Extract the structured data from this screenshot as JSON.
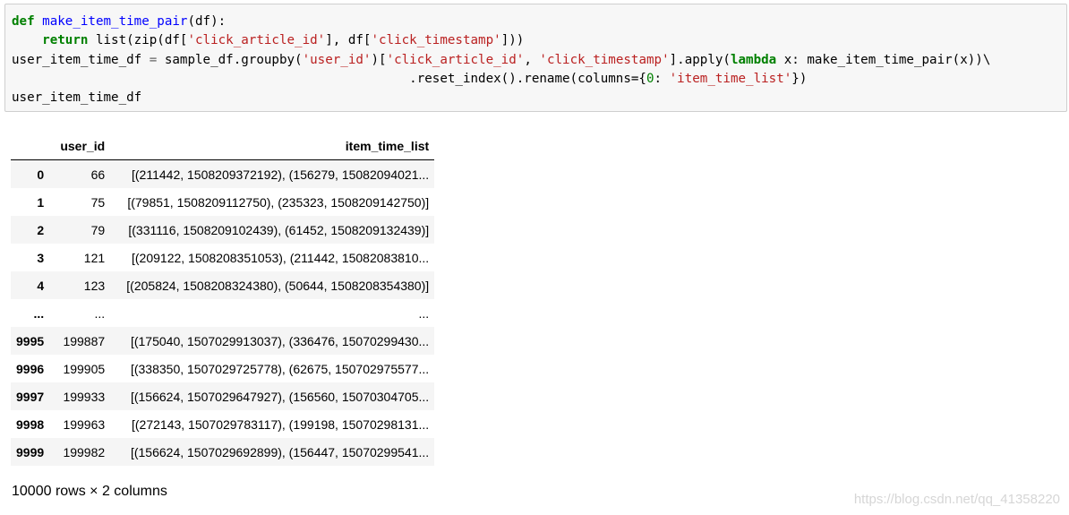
{
  "code": {
    "line1": {
      "kw": "def",
      "name": "make_item_time_pair",
      "rest": "(df):"
    },
    "line2": {
      "indent": "    ",
      "kw": "return",
      "p1": " list(zip(df[",
      "s1": "'click_article_id'",
      "p2": "], df[",
      "s2": "'click_timestamp'",
      "p3": "]))"
    },
    "line3": {
      "p1": "user_item_time_df ",
      "eq": "=",
      "p2": " sample_df.groupby(",
      "s1": "'user_id'",
      "p3": ")[",
      "s2": "'click_article_id'",
      "p4": ", ",
      "s3": "'click_timestamp'",
      "p5": "].apply(",
      "kw": "lambda",
      "p6": " x: make_item_time_pair(x))\\"
    },
    "line4": {
      "indent": "                                                    ",
      "p1": ".reset_index().rename(columns={",
      "num": "0",
      "p2": ": ",
      "s1": "'item_time_list'",
      "p3": "})"
    },
    "line5": "user_item_time_df"
  },
  "table": {
    "columns": [
      "",
      "user_id",
      "item_time_list"
    ],
    "rows": [
      {
        "index": "0",
        "user_id": "66",
        "item_time_list": "[(211442, 1508209372192), (156279, 15082094021..."
      },
      {
        "index": "1",
        "user_id": "75",
        "item_time_list": "[(79851, 1508209112750), (235323, 1508209142750)]"
      },
      {
        "index": "2",
        "user_id": "79",
        "item_time_list": "[(331116, 1508209102439), (61452, 1508209132439)]"
      },
      {
        "index": "3",
        "user_id": "121",
        "item_time_list": "[(209122, 1508208351053), (211442, 15082083810..."
      },
      {
        "index": "4",
        "user_id": "123",
        "item_time_list": "[(205824, 1508208324380), (50644, 1508208354380)]"
      },
      {
        "index": "...",
        "user_id": "...",
        "item_time_list": "..."
      },
      {
        "index": "9995",
        "user_id": "199887",
        "item_time_list": "[(175040, 1507029913037), (336476, 15070299430..."
      },
      {
        "index": "9996",
        "user_id": "199905",
        "item_time_list": "[(338350, 1507029725778), (62675, 150702975577..."
      },
      {
        "index": "9997",
        "user_id": "199933",
        "item_time_list": "[(156624, 1507029647927), (156560, 15070304705..."
      },
      {
        "index": "9998",
        "user_id": "199963",
        "item_time_list": "[(272143, 1507029783117), (199198, 15070298131..."
      },
      {
        "index": "9999",
        "user_id": "199982",
        "item_time_list": "[(156624, 1507029692899), (156447, 15070299541..."
      }
    ]
  },
  "shape_text": "10000 rows × 2 columns",
  "watermark": "https://blog.csdn.net/qq_41358220",
  "colors": {
    "keyword": "#008000",
    "function_name": "#0000ff",
    "string": "#ba2121",
    "cell_background": "#f7f7f7",
    "row_stripe": "#f5f5f5"
  }
}
